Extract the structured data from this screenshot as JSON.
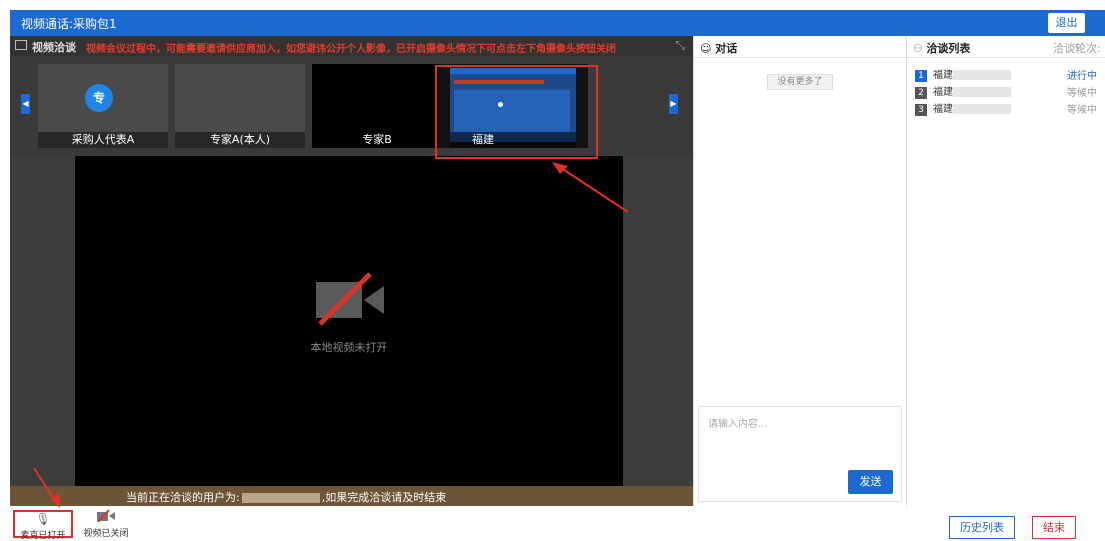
{
  "window": {
    "title": "视频通话:采购包1",
    "exit_label": "退出"
  },
  "video": {
    "header_label": "视频洽谈",
    "notice": "视频会议过程中，可能需要邀请供应商加入，如您避讳公开个人影像，已开启摄像头情况下可点击左下角摄像头按钮关闭",
    "participants": [
      {
        "name": "采购人代表A",
        "avatar": "专"
      },
      {
        "name": "专家A(本人)"
      },
      {
        "name": "专家B"
      },
      {
        "name": "福建"
      }
    ],
    "local_video_off_text": "本地视频未打开",
    "status_prefix": "当前正在洽谈的用户为:",
    "status_suffix": ",如果完成洽谈请及时结束"
  },
  "chat": {
    "title": "对话",
    "no_more": "没有更多了",
    "input_placeholder": "请输入内容...",
    "send_label": "发送"
  },
  "negotiation": {
    "title": "洽谈列表",
    "round_label": "洽谈轮次:",
    "items": [
      {
        "num": "1",
        "name": "福建",
        "status": "进行中"
      },
      {
        "num": "2",
        "name": "福建",
        "status": "等候中"
      },
      {
        "num": "3",
        "name": "福建",
        "status": "等候中"
      }
    ]
  },
  "controls": {
    "mic_label": "麦克已打开",
    "camera_label": "视频已关闭",
    "history_label": "历史列表",
    "end_label": "结束"
  },
  "colors": {
    "accent": "#1c6ad1",
    "alert": "#e0302a",
    "status_bar": "#6e5436"
  }
}
